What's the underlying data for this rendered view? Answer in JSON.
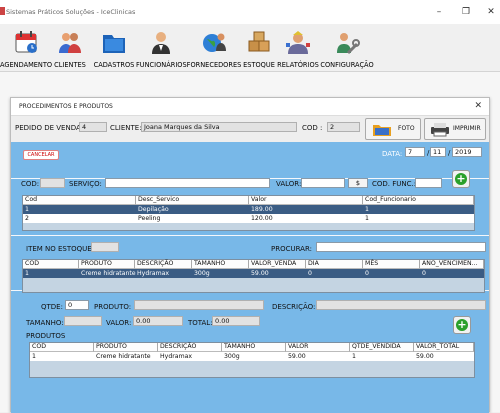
{
  "app": {
    "title": "Sistemas Práticos Soluções - IceClinicas"
  },
  "window_controls": {
    "minimize": "–",
    "restore": "❐",
    "close": "✕"
  },
  "toolbar": [
    {
      "label": "AGENDAMENTO",
      "icon": "calendar-icon"
    },
    {
      "label": "CLIENTES",
      "icon": "clients-icon"
    },
    {
      "label": "CADASTROS",
      "icon": "folder-icon"
    },
    {
      "label": "FUNCIONÁRIOS",
      "icon": "employees-icon"
    },
    {
      "label": "FORNECEDORES",
      "icon": "globe-person-icon"
    },
    {
      "label": "ESTOQUE",
      "icon": "boxes-icon"
    },
    {
      "label": "RELATÓRIOS",
      "icon": "reports-icon"
    },
    {
      "label": "CONFIGURAÇÃO",
      "icon": "wrench-icon"
    }
  ],
  "dialog": {
    "title": "PROCEDIMENTOS E PRODUTOS",
    "close": "✕",
    "pedido_label": "PEDIDO DE VENDA",
    "pedido_value": "4",
    "cliente_label": "CLIENTE:",
    "cliente_value": "Joana Marques da Silva",
    "cod_label": "COD :",
    "cod_value": "2",
    "foto_button": "FOTO",
    "imprimir_button": "IMPRIMIR",
    "cancel_button": "CANCELAR",
    "data_label": "DATA:",
    "date_day": "7",
    "date_month": "11",
    "date_year": "2019",
    "date_sep": "/"
  },
  "servico_form": {
    "cod_label": "COD:",
    "servico_label": "SERVIÇO:",
    "valor_label": "VALOR:",
    "currency_button": "$",
    "cod_func_label": "COD. FUNC.:"
  },
  "servicos_table": {
    "headers": [
      "Cod",
      "Desc_Servico",
      "Valor",
      "Cod_Funcionario"
    ],
    "rows": [
      [
        "1",
        "Depilação",
        "189.00",
        "1"
      ],
      [
        "2",
        "Peeling",
        "120.00",
        "1"
      ]
    ]
  },
  "estoque_form": {
    "item_label": "ITEM NO ESTOQUE:",
    "procurar_label": "PROCURAR:"
  },
  "estoque_table": {
    "headers": [
      "COD",
      "PRODUTO",
      "DESCRIÇÃO",
      "TAMANHO",
      "VALOR_VENDA",
      "DIA",
      "MÊS",
      "ANO_VENCIMEN..."
    ],
    "rows": [
      [
        "1",
        "Creme hidratante",
        "Hydramax",
        "300g",
        "59.00",
        "0",
        "0",
        "0"
      ]
    ]
  },
  "produto_form": {
    "qtde_label": "QTDE:",
    "qtde_value": "0",
    "produto_label": "PRODUTO:",
    "descricao_label": "DESCRIÇÃO:",
    "tamanho_label": "TAMANHO:",
    "valor_label": "VALOR:",
    "valor_value": "0.00",
    "total_label": "TOTAL:",
    "total_value": "0.00"
  },
  "produtos_section": {
    "title": "PRODUTOS"
  },
  "produtos_table": {
    "headers": [
      "COD",
      "PRODUTO",
      "DESCRIÇÃO",
      "TAMANHO",
      "VALOR",
      "QTDE_VENDIDA",
      "VALOR_TOTAL"
    ],
    "rows": [
      [
        "1",
        "Creme hidratante",
        "Hydramax",
        "300g",
        "59.00",
        "1",
        "59.00"
      ]
    ]
  },
  "colors": {
    "panel_blue": "#78b8e8",
    "selection": "#3a5c84",
    "add_green": "#2aa02a"
  }
}
